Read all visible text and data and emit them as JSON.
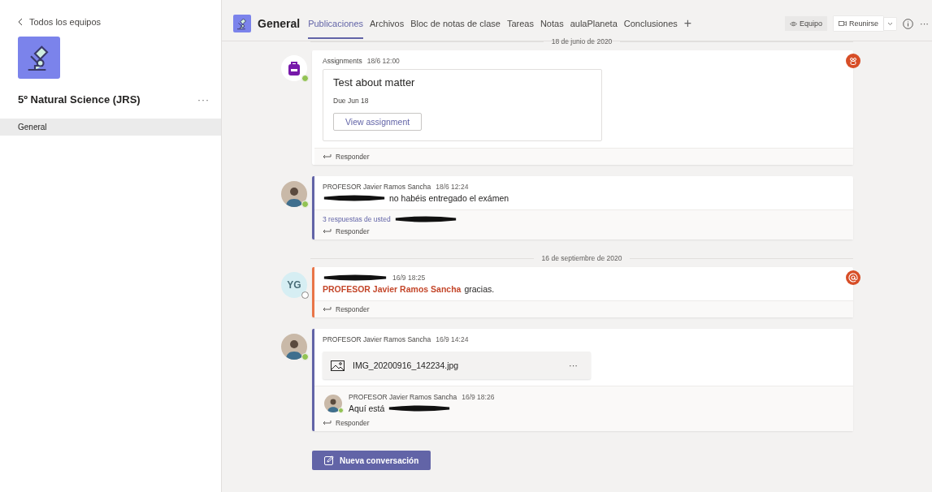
{
  "sidebar": {
    "back_label": "Todos los equipos",
    "team_name": "5º Natural Science (JRS)",
    "more": "···",
    "channels": [
      {
        "label": "General",
        "selected": true
      }
    ]
  },
  "header": {
    "channel_title": "General",
    "tabs": [
      {
        "label": "Publicaciones",
        "selected": true
      },
      {
        "label": "Archivos",
        "selected": false
      },
      {
        "label": "Bloc de notas de clase",
        "selected": false
      },
      {
        "label": "Tareas",
        "selected": false
      },
      {
        "label": "Notas",
        "selected": false
      },
      {
        "label": "aulaPlaneta",
        "selected": false
      },
      {
        "label": "Conclusiones",
        "selected": false
      }
    ],
    "add_tab": "+",
    "team_button": "Equipo",
    "meet_button": "Reunirse",
    "more": "···"
  },
  "feed": [
    {
      "kind": "date",
      "label": "18 de junio de 2020"
    },
    {
      "kind": "post",
      "avatar": {
        "kind": "app",
        "online": true
      },
      "badge": {
        "kind": "group"
      },
      "author": [
        {
          "kind": "text",
          "text": "Assignments"
        }
      ],
      "time": "18/6 12:00",
      "card": {
        "title": "Test about matter",
        "due": "Due Jun 18",
        "button": "View assignment"
      },
      "reply_label": "Responder"
    },
    {
      "kind": "post",
      "avatar": {
        "kind": "photo",
        "online": true
      },
      "color": "#6264a7",
      "author": [
        {
          "kind": "text",
          "text": "PROFESOR Javier Ramos Sancha"
        }
      ],
      "time": "18/6 12:24",
      "body": [
        {
          "kind": "redacted"
        },
        {
          "kind": "text",
          "text": "no habéis entregado el exámen"
        }
      ],
      "replies": [
        {
          "kind": "text",
          "text": "3 respuestas de usted"
        },
        {
          "kind": "redacted"
        }
      ],
      "reply_label": "Responder"
    },
    {
      "kind": "date",
      "label": "16 de septiembre de 2020"
    },
    {
      "kind": "post",
      "avatar": {
        "kind": "initials",
        "initials": "YG",
        "online": false
      },
      "color": "#e97548",
      "badge": {
        "kind": "mention"
      },
      "author": [
        {
          "kind": "redacted"
        }
      ],
      "time": "16/9 18:25",
      "body": [
        {
          "kind": "mention",
          "text": "PROFESOR Javier Ramos Sancha"
        },
        {
          "kind": "text",
          "text": "gracias."
        }
      ],
      "reply_label": "Responder"
    },
    {
      "kind": "post",
      "avatar": {
        "kind": "photo",
        "online": true
      },
      "color": "#6264a7",
      "author": [
        {
          "kind": "text",
          "text": "PROFESOR Javier Ramos Sancha"
        }
      ],
      "time": "16/9 14:24",
      "attachment": {
        "name": "IMG_20200916_142234.jpg",
        "more": "···"
      },
      "thread_reply": {
        "avatar": {
          "kind": "photo",
          "online": true
        },
        "author": "PROFESOR Javier Ramos Sancha",
        "time": "16/9 18:26",
        "body": [
          {
            "kind": "text",
            "text": "Aquí está"
          },
          {
            "kind": "redacted"
          }
        ]
      },
      "reply_label": "Responder"
    }
  ],
  "compose_button": "Nueva conversación"
}
